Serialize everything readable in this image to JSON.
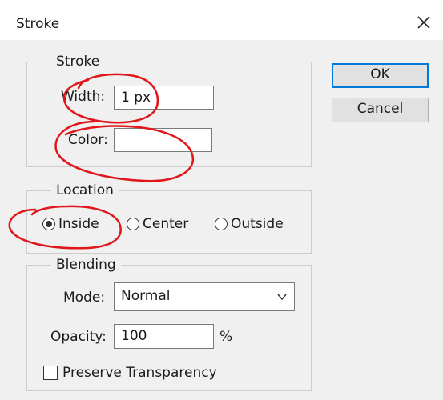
{
  "window": {
    "title": "Stroke"
  },
  "stroke_group": {
    "legend": "Stroke",
    "width_label": "Width:",
    "width_value": "1 px",
    "color_label": "Color:",
    "color_value": ""
  },
  "location_group": {
    "legend": "Location",
    "options": [
      {
        "label": "Inside",
        "selected": true
      },
      {
        "label": "Center",
        "selected": false
      },
      {
        "label": "Outside",
        "selected": false
      }
    ]
  },
  "blending_group": {
    "legend": "Blending",
    "mode_label": "Mode:",
    "mode_value": "Normal",
    "opacity_label": "Opacity:",
    "opacity_value": "100",
    "opacity_unit": "%",
    "preserve_label": "Preserve Transparency",
    "preserve_checked": false
  },
  "buttons": {
    "ok": "OK",
    "cancel": "Cancel"
  },
  "colors": {
    "annotation": "#e0161b",
    "default_button_border": "#0078d7",
    "dialog_bg": "#f0f0f0"
  }
}
